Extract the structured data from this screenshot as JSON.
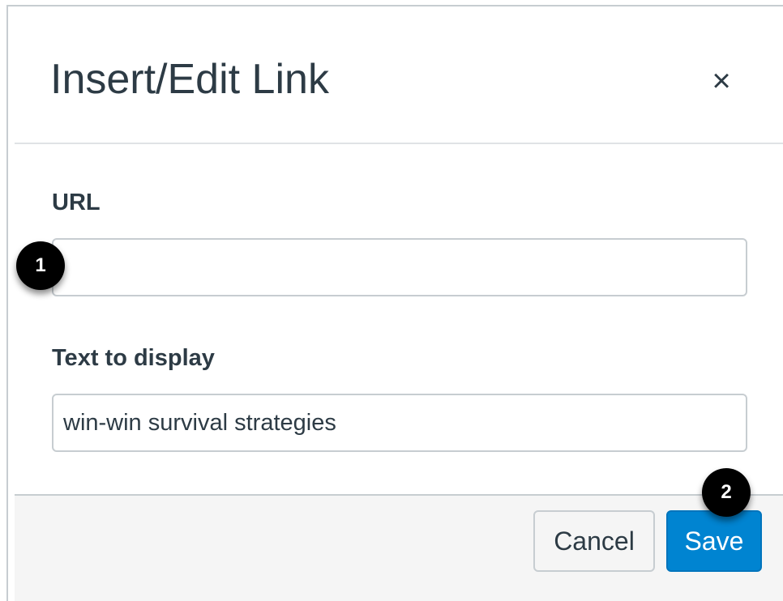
{
  "dialog": {
    "title": "Insert/Edit Link",
    "close_glyph": "×"
  },
  "fields": {
    "url": {
      "label": "URL",
      "value": ""
    },
    "text_to_display": {
      "label": "Text to display",
      "value": "win-win survival strategies"
    }
  },
  "footer": {
    "cancel_label": "Cancel",
    "save_label": "Save"
  },
  "callouts": [
    "1",
    "2"
  ],
  "colors": {
    "save_button": "#0084d1",
    "title_text": "#2d3b45",
    "callout": "#000000"
  }
}
